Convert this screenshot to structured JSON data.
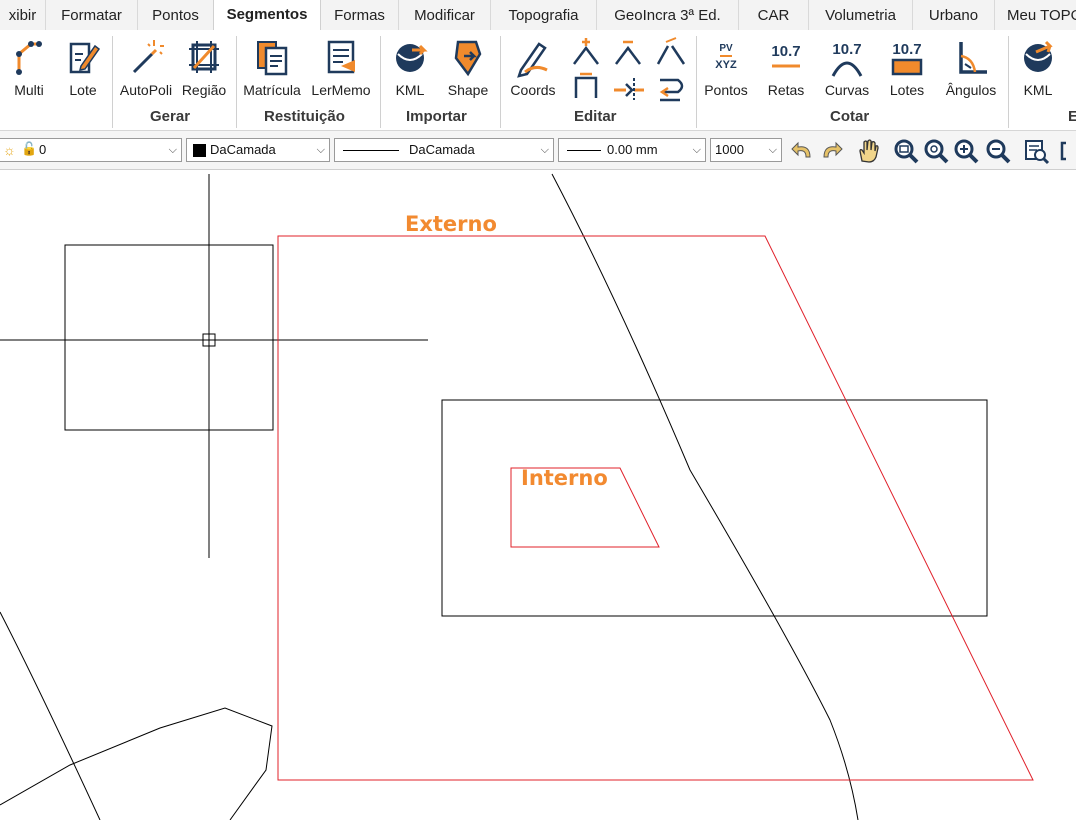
{
  "tabs": [
    "xibir",
    "Formatar",
    "Pontos",
    "Segmentos",
    "Formas",
    "Modificar",
    "Topografia",
    "GeoIncra 3ª Ed.",
    "CAR",
    "Volumetria",
    "Urbano",
    "Meu TOPO"
  ],
  "active_tab": "Segmentos",
  "ribbon": {
    "buttons": {
      "multi": "Multi",
      "lote": "Lote",
      "autopoli": "AutoPoli",
      "regiao": "Região",
      "matricula": "Matrícula",
      "lermemo": "LerMemo",
      "kml": "KML",
      "shape": "Shape",
      "coords": "Coords",
      "pontos": "Pontos",
      "retas": "Retas",
      "curvas": "Curvas",
      "lotes": "Lotes",
      "angulos": "Ângulos",
      "kml2": "KML"
    },
    "groups": {
      "gerar": "Gerar",
      "restituicao": "Restituição",
      "importar": "Importar",
      "editar": "Editar",
      "cotar": "Cotar",
      "extra": "E"
    },
    "icon_text": {
      "pv": "PV",
      "xyz": "XYZ",
      "num": "10.7"
    }
  },
  "propbar": {
    "layer_value": "0",
    "color_value": "DaCamada",
    "linetype_value": "DaCamada",
    "lineweight_value": "0.00 mm",
    "scale_value": "1000"
  },
  "canvas": {
    "label_externo": "Externo",
    "label_interno": "Interno"
  },
  "colors": {
    "accent_orange": "#f28a30",
    "polygon_red": "#e0202a",
    "icon_navy": "#1f3a5c",
    "icon_orange": "#f08a2c"
  }
}
